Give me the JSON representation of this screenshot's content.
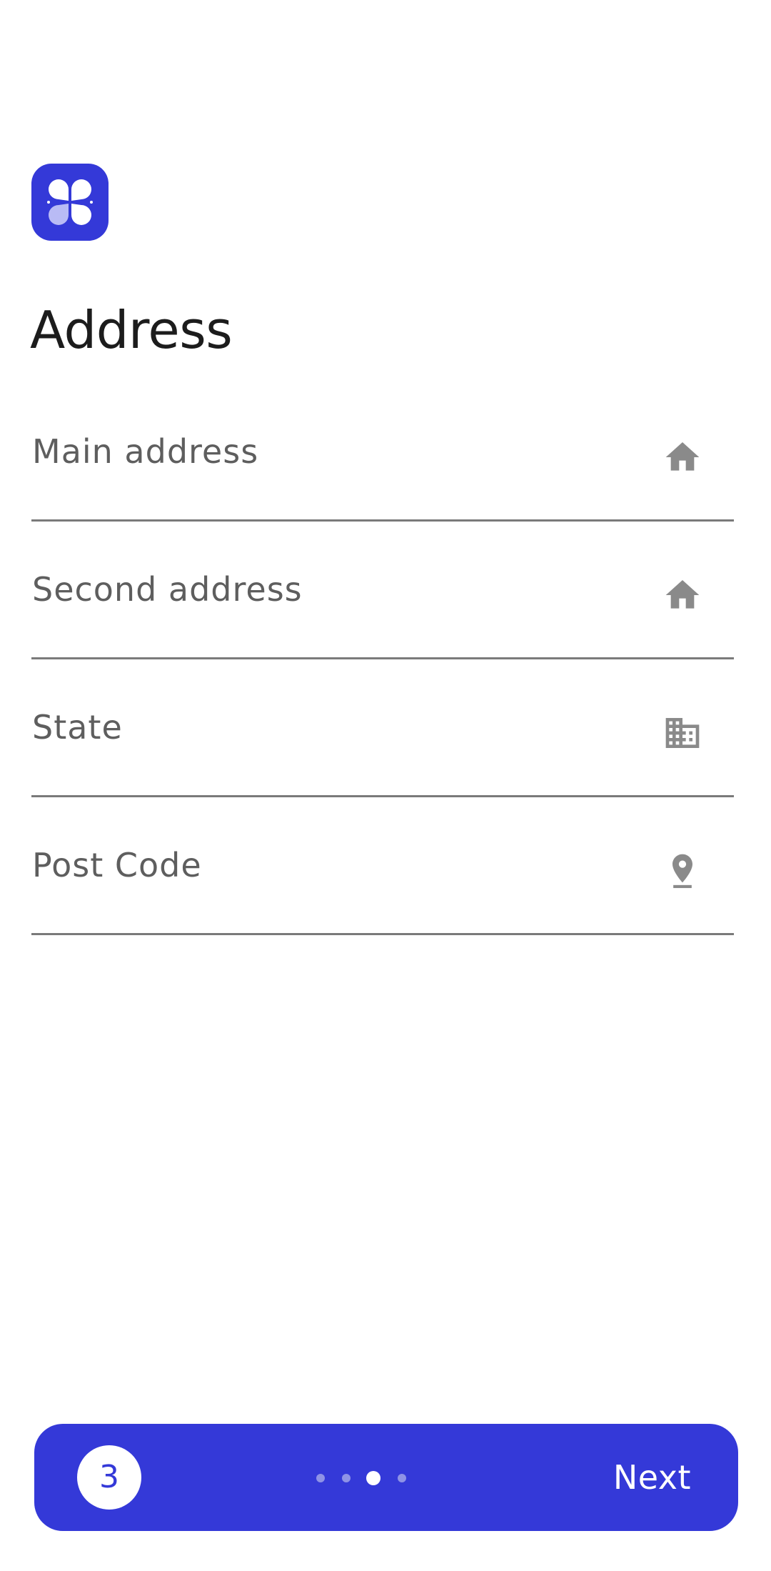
{
  "header": {
    "logo_icon": "clover-app-icon",
    "title": "Address"
  },
  "form": {
    "fields": [
      {
        "label": "Main address",
        "icon": "home-icon"
      },
      {
        "label": "Second address",
        "icon": "home-icon"
      },
      {
        "label": "State",
        "icon": "building-icon"
      },
      {
        "label": "Post Code",
        "icon": "location-pin-icon"
      }
    ]
  },
  "footer": {
    "step_number": "3",
    "page_count": 4,
    "active_page": 3,
    "next_label": "Next"
  },
  "colors": {
    "accent": "#3439d8",
    "icon_gray": "#8a8a8a",
    "underline": "#7a7a7a",
    "label_gray": "#5e5e5e"
  }
}
